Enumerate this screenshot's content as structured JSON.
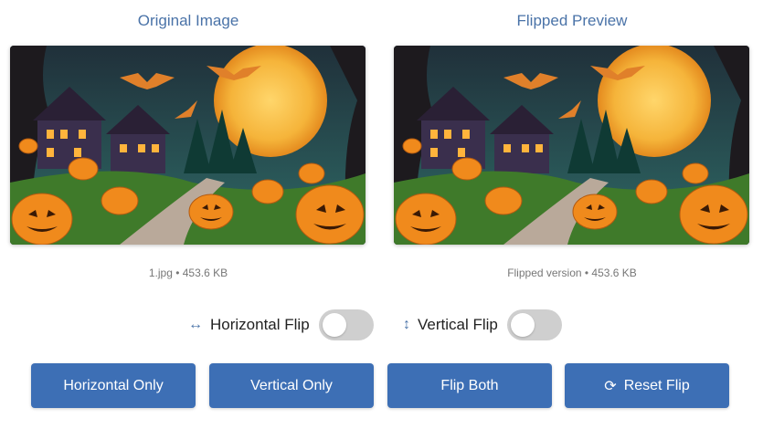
{
  "panels": {
    "original": {
      "title": "Original Image",
      "caption": "1.jpg • 453.6 KB"
    },
    "preview": {
      "title": "Flipped Preview",
      "caption": "Flipped version • 453.6 KB"
    }
  },
  "toggles": {
    "horizontal": {
      "icon": "↔",
      "label": "Horizontal Flip",
      "on": false
    },
    "vertical": {
      "icon": "↕",
      "label": "Vertical Flip",
      "on": false
    }
  },
  "buttons": {
    "horizontal_only": "Horizontal Only",
    "vertical_only": "Vertical Only",
    "flip_both": "Flip Both",
    "reset_flip": "Reset Flip",
    "reset_icon": "⟳"
  },
  "colors": {
    "accent": "#3d6fb5",
    "title": "#4a73a8"
  }
}
